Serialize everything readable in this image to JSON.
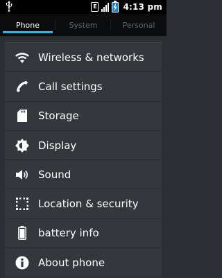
{
  "status_bar": {
    "usb_icon": "usb-icon",
    "network_type": "E",
    "time": "4:13 pm",
    "battery_color": "#1e7fd6"
  },
  "tabs": [
    {
      "label": "Phone",
      "active": true
    },
    {
      "label": "System",
      "active": false
    },
    {
      "label": "Personal",
      "active": false
    }
  ],
  "accent_color": "#33b5e5",
  "settings": {
    "items": [
      {
        "label": "Wireless & networks",
        "icon": "wifi-icon"
      },
      {
        "label": "Call settings",
        "icon": "phone-icon"
      },
      {
        "label": "Storage",
        "icon": "sd-card-icon"
      },
      {
        "label": "Display",
        "icon": "brightness-icon"
      },
      {
        "label": "Sound",
        "icon": "speaker-icon"
      },
      {
        "label": "Location & security",
        "icon": "location-grid-icon"
      },
      {
        "label": "battery info",
        "icon": "battery-icon"
      },
      {
        "label": "About phone",
        "icon": "info-icon"
      }
    ]
  }
}
